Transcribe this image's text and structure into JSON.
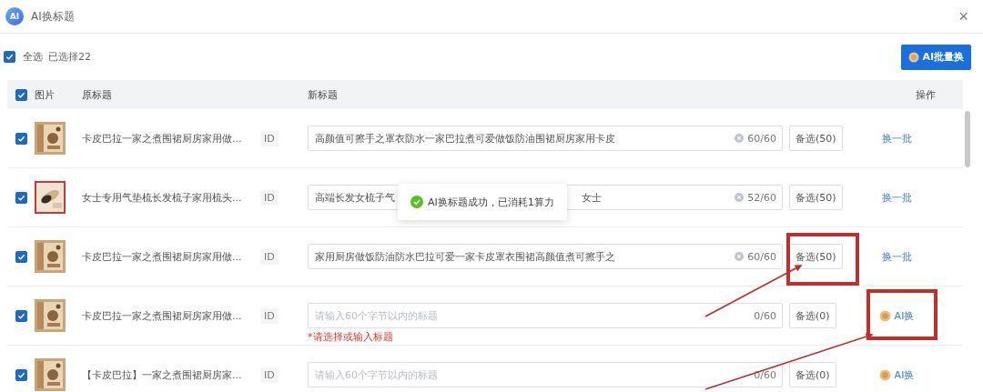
{
  "window": {
    "logo_text": "AI",
    "title": "AI换标题",
    "close": "×"
  },
  "toolbar": {
    "select_all": {
      "label": "全选",
      "checked": true
    },
    "selected_count": "已选择22",
    "batch_button": "AI批量换"
  },
  "table": {
    "header_checked": true,
    "columns": [
      "图片",
      "原标题",
      "新标题",
      "操作"
    ],
    "rows": [
      {
        "checked": true,
        "original_title": "卡皮巴拉一家之煮围裙厨房家用做...",
        "id_label": "ID",
        "new_title": {
          "value_parts": [
            "高颜值可擦手之罩衣防水一家巴拉煮可爱做饭防油围裙厨房家用卡皮"
          ],
          "counter": "60/60"
        },
        "alt_button": {
          "label": "备选(50)",
          "highlighted": false
        },
        "action": {
          "kind": "refresh",
          "label": "换一批",
          "highlighted": false
        }
      },
      {
        "checked": true,
        "original_title": "女士专用气垫梳长发梳子家用梳头...",
        "id_label": "ID",
        "new_title": {
          "value_parts": [
            "高端长发女梳子气",
            "女士"
          ],
          "counter": "52/60"
        },
        "alt_button": {
          "label": "备选(50)",
          "highlighted": false
        },
        "action": {
          "kind": "refresh",
          "label": "换一批",
          "highlighted": false
        }
      },
      {
        "checked": true,
        "original_title": "卡皮巴拉一家之煮围裙厨房家用做...",
        "id_label": "ID",
        "new_title": {
          "value_parts": [
            "家用厨房做饭防油防水巴拉可爱一家卡皮罩衣围裙高颜值煮可擦手之"
          ],
          "counter": "60/60"
        },
        "alt_button": {
          "label": "备选(50)",
          "highlighted": true
        },
        "action": {
          "kind": "refresh",
          "label": "换一批",
          "highlighted": false
        }
      },
      {
        "checked": true,
        "original_title": "卡皮巴拉一家之煮围裙厨房家用做...",
        "id_label": "ID",
        "new_title": {
          "placeholder": "请输入60个字节以内的标题",
          "counter": "0/60",
          "error": "*请选择或输入标题"
        },
        "alt_button": {
          "label": "备选(0)",
          "highlighted": false
        },
        "action": {
          "kind": "ai",
          "label": "AI换",
          "highlighted": true
        }
      },
      {
        "checked": true,
        "original_title": "【卡皮巴拉】一家之煮围裙厨房家...",
        "id_label": "ID",
        "new_title": {
          "placeholder": "请输入60个字节以内的标题",
          "counter": "0/60"
        },
        "alt_button": {
          "label": "备选(0)",
          "highlighted": false
        },
        "action": {
          "kind": "ai",
          "label": "AI换",
          "highlighted": false
        }
      }
    ]
  },
  "toast": {
    "message": "AI换标题成功，已消耗1算力"
  }
}
